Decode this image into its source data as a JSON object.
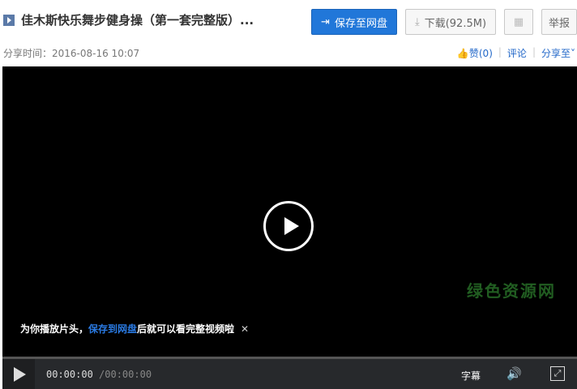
{
  "header": {
    "title": "佳木斯快乐舞步健身操（第一套完整版）...",
    "save_label": "保存至网盘",
    "download_label": "下载(92.5M)",
    "report_label": "举报"
  },
  "meta": {
    "share_time": "分享时间：2016-08-16 10:07",
    "like": "赞(0)",
    "comment": "评论",
    "share": "分享至"
  },
  "player": {
    "notice_prefix": "为你播放片头，",
    "notice_link": "保存到网盘",
    "notice_suffix": "后就可以看完整视频啦",
    "current_time": "00:00:00",
    "total_time": "/00:00:00",
    "subtitle_label": "字幕"
  },
  "watermark": "绿色资源网"
}
